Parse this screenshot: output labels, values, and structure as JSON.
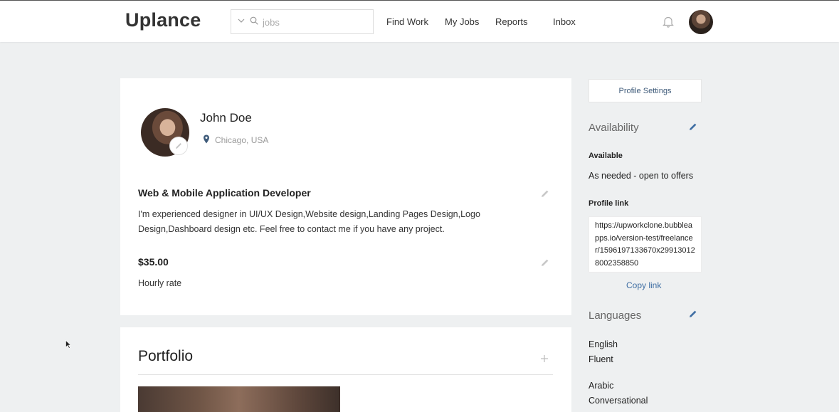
{
  "header": {
    "logo": "Uplance",
    "search": {
      "placeholder": "jobs"
    },
    "nav": [
      "Find Work",
      "My Jobs",
      "Reports",
      "Inbox"
    ]
  },
  "profile": {
    "name": "John Doe",
    "location": "Chicago, USA",
    "title": "Web & Mobile Application Developer",
    "bio": "I'm experienced designer in UI/UX Design,Website design,Landing Pages Design,Logo Design,Dashboard design etc. Feel free to contact me if you have any project.",
    "rate": "$35.00",
    "rate_label": "Hourly rate"
  },
  "portfolio": {
    "title": "Portfolio"
  },
  "sidebar": {
    "settings_button": "Profile Settings",
    "availability": {
      "heading": "Availability",
      "label": "Available",
      "value": "As needed - open to offers"
    },
    "profile_link": {
      "label": "Profile link",
      "url": "https://upworkclone.bubbleapps.io/version-test/freelancer/1596197133670x299130128002358850",
      "copy_label": "Copy link"
    },
    "languages": {
      "heading": "Languages",
      "items": [
        {
          "name": "English",
          "level": "Fluent"
        },
        {
          "name": "Arabic",
          "level": "Conversational"
        }
      ]
    }
  },
  "colors": {
    "background": "#eef0f1",
    "accent_blue": "#3f6ea3",
    "settings_text": "#3f5b7a"
  }
}
